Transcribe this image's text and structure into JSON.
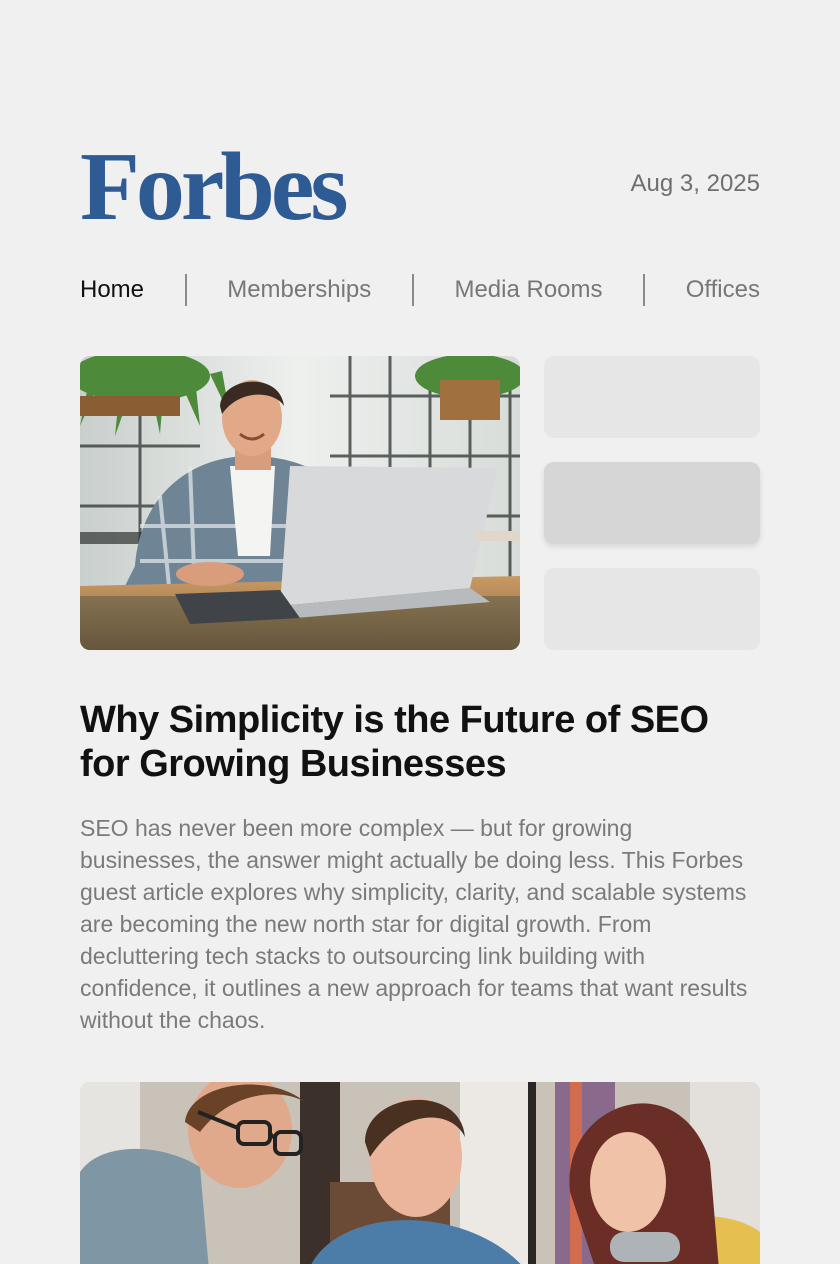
{
  "brand": {
    "logo_text": "Forbes",
    "color": "#2f5b94"
  },
  "header": {
    "date": "Aug 3, 2025"
  },
  "nav": {
    "items": [
      {
        "label": "Home",
        "active": true
      },
      {
        "label": "Memberships",
        "active": false
      },
      {
        "label": "Media Rooms",
        "active": false
      },
      {
        "label": "Offices",
        "active": false
      }
    ]
  },
  "hero": {
    "image": "man-working-on-laptop-photo"
  },
  "thumbnails": [
    {
      "state": "placeholder"
    },
    {
      "state": "selected"
    },
    {
      "state": "placeholder"
    }
  ],
  "article": {
    "title": "Why Simplicity is the Future of SEO for Growing Businesses",
    "excerpt": "SEO has never been more complex — but for growing businesses, the answer might actually be doing less. This Forbes guest article explores why simplicity, clarity, and scalable systems are becoming the new north star for digital growth. From decluttering tech stacks to outsourcing link building with confidence, it outlines a new approach for teams that want results without the chaos."
  },
  "next_article": {
    "image": "team-collaborating-photo"
  }
}
